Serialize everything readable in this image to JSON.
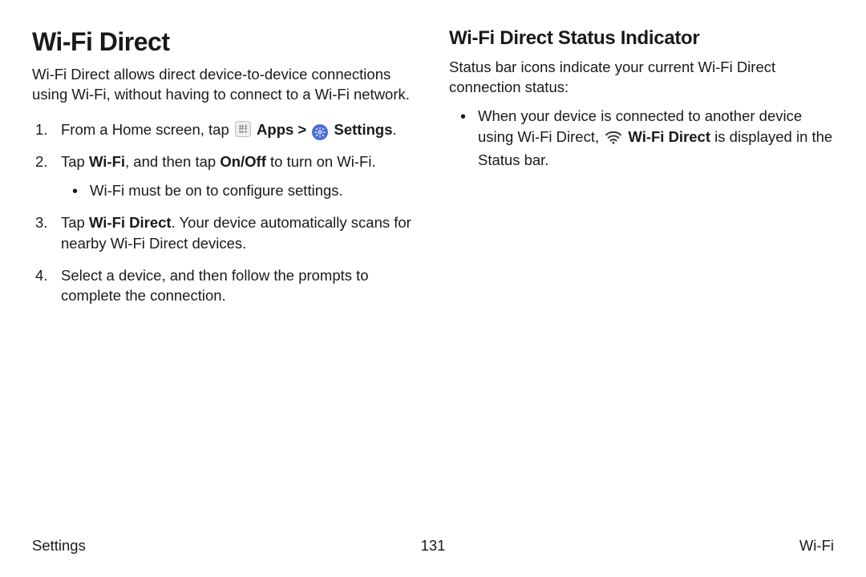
{
  "left": {
    "heading": "Wi-Fi Direct",
    "intro": "Wi-Fi Direct allows direct device-to-device connections using Wi-Fi, without having to connect to a Wi-Fi network.",
    "step1_prefix": "From a Home screen, tap ",
    "step1_apps": "Apps",
    "step1_chevron": " > ",
    "step1_settings": "Settings",
    "step1_suffix": ".",
    "step2_a": "Tap ",
    "step2_b": "Wi-Fi",
    "step2_c": ", and then tap ",
    "step2_d": "On/Off",
    "step2_e": " to turn on Wi-Fi.",
    "step2_sub": "Wi-Fi must be on to configure settings.",
    "step3_a": "Tap ",
    "step3_b": "Wi-Fi Direct",
    "step3_c": ". Your device automatically scans for nearby Wi-Fi Direct devices.",
    "step4": "Select a device, and then follow the prompts to complete the connection."
  },
  "right": {
    "heading": "Wi-Fi Direct Status Indicator",
    "intro": "Status bar icons indicate your current Wi-Fi Direct connection status:",
    "bullet_a": "When your device is connected to another device using Wi-Fi Direct, ",
    "bullet_b": "Wi-Fi Direct",
    "bullet_c": " is displayed in the Status bar."
  },
  "footer": {
    "left": "Settings",
    "center": "131",
    "right": "Wi-Fi"
  }
}
